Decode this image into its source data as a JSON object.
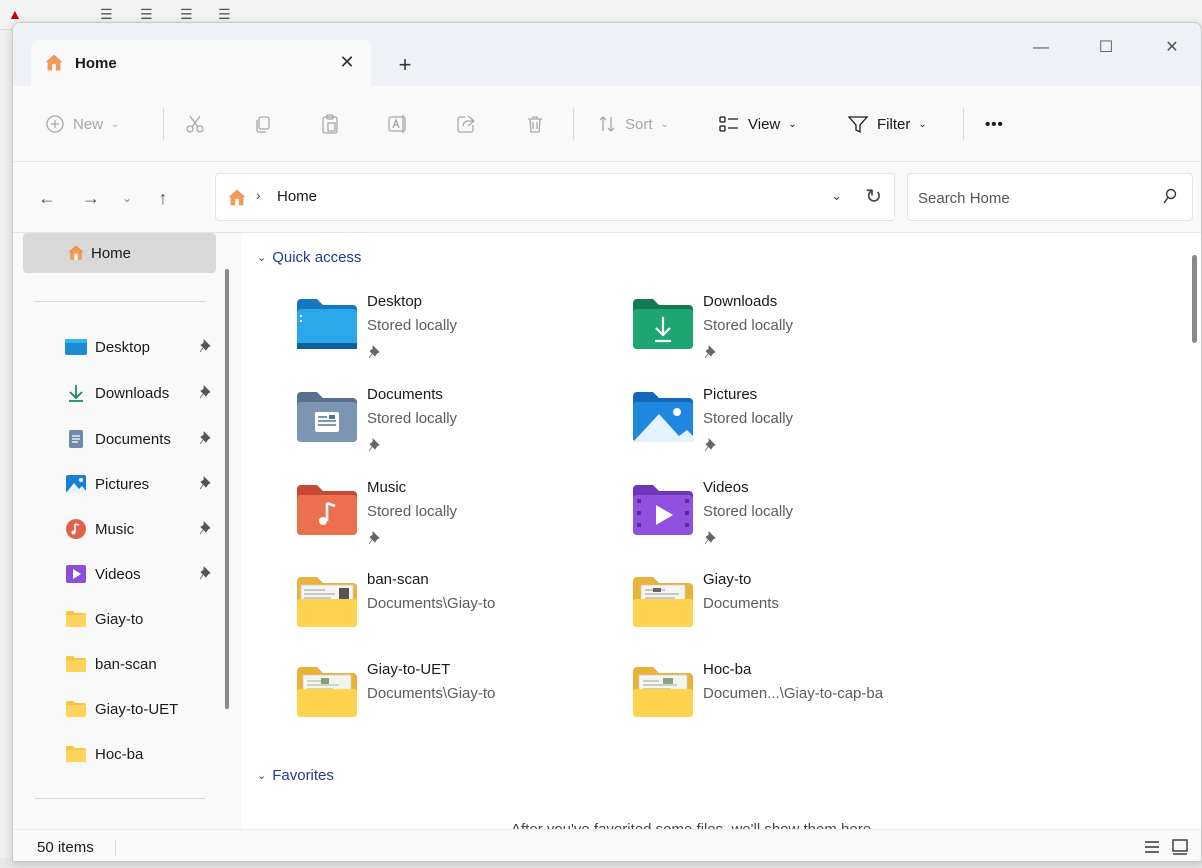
{
  "window": {
    "tab_title": "Home",
    "tab_close": "✕",
    "new_tab": "+"
  },
  "window_controls": {
    "minimize": "—",
    "maximize": "☐",
    "close": "✕"
  },
  "command_bar": {
    "new_label": "New",
    "sort_label": "Sort",
    "view_label": "View",
    "filter_label": "Filter",
    "more_label": "•••"
  },
  "address": {
    "separator": "›",
    "path": "Home"
  },
  "search": {
    "placeholder": "Search Home"
  },
  "sidebar": {
    "home": {
      "label": "Home"
    },
    "items": [
      {
        "label": "Desktop",
        "icon": "desktop-folder-icon",
        "pinned": true
      },
      {
        "label": "Downloads",
        "icon": "download-icon",
        "pinned": true
      },
      {
        "label": "Documents",
        "icon": "documents-icon",
        "pinned": true
      },
      {
        "label": "Pictures",
        "icon": "pictures-icon",
        "pinned": true
      },
      {
        "label": "Music",
        "icon": "music-icon",
        "pinned": true
      },
      {
        "label": "Videos",
        "icon": "videos-icon",
        "pinned": true
      },
      {
        "label": "Giay-to",
        "icon": "folder-icon",
        "pinned": false
      },
      {
        "label": "ban-scan",
        "icon": "folder-icon",
        "pinned": false
      },
      {
        "label": "Giay-to-UET",
        "icon": "folder-icon",
        "pinned": false
      },
      {
        "label": "Hoc-ba",
        "icon": "folder-icon",
        "pinned": false
      }
    ]
  },
  "content": {
    "quick_access": {
      "heading": "Quick access",
      "items": [
        {
          "name": "Desktop",
          "location": "Stored locally",
          "pinned": true,
          "icon": "desktop-folder-icon"
        },
        {
          "name": "Downloads",
          "location": "Stored locally",
          "pinned": true,
          "icon": "downloads-folder-icon"
        },
        {
          "name": "Documents",
          "location": "Stored locally",
          "pinned": true,
          "icon": "documents-folder-icon"
        },
        {
          "name": "Pictures",
          "location": "Stored locally",
          "pinned": true,
          "icon": "pictures-folder-icon"
        },
        {
          "name": "Music",
          "location": "Stored locally",
          "pinned": true,
          "icon": "music-folder-icon"
        },
        {
          "name": "Videos",
          "location": "Stored locally",
          "pinned": true,
          "icon": "videos-folder-icon"
        },
        {
          "name": "ban-scan",
          "location": "Documents\\Giay-to",
          "pinned": false,
          "icon": "folder-thumb-icon"
        },
        {
          "name": "Giay-to",
          "location": "Documents",
          "pinned": false,
          "icon": "folder-thumb-icon"
        },
        {
          "name": "Giay-to-UET",
          "location": "Documents\\Giay-to",
          "pinned": false,
          "icon": "folder-thumb-icon"
        },
        {
          "name": "Hoc-ba",
          "location": "Documen...\\Giay-to-cap-ba",
          "pinned": false,
          "icon": "folder-thumb-icon"
        }
      ]
    },
    "favorites": {
      "heading": "Favorites",
      "empty_text": "After you've favorited some files, we'll show them here."
    }
  },
  "status": {
    "item_count": "50 items"
  },
  "colors": {
    "accent": "#1e3d8f",
    "selected_bg": "#d9d9d9",
    "folder_yellow": "#f5c544"
  }
}
